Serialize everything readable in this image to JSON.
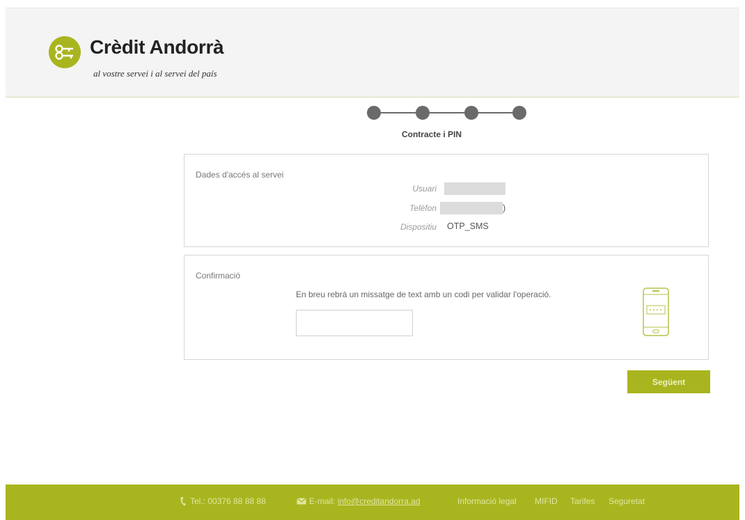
{
  "brand": {
    "name": "Crèdit Andorrà",
    "tagline": "al vostre servei i al servei del país",
    "color": "#a9b51f"
  },
  "steps": {
    "count": 4,
    "current_label": "Contracte i PIN"
  },
  "access_panel": {
    "title": "Dades d'accés al servei",
    "fields": [
      {
        "label": "Usuari",
        "value": ""
      },
      {
        "label": "Telèfon",
        "value": ")"
      },
      {
        "label": "Dispositiu",
        "value": "OTP_SMS"
      }
    ]
  },
  "confirm_panel": {
    "title": "Confirmació",
    "message": "En breu rebrà un missatge de text amb un codi per validar l'operació.",
    "code_input": {
      "value": "",
      "placeholder": ""
    },
    "icon": "smartphone-icon"
  },
  "actions": {
    "next_label": "Següent"
  },
  "footer": {
    "phone": "Tel.: 00376 88 88 88",
    "email_label": "E-mail: ",
    "email": "info@creditandorra.ad",
    "links": [
      "Informació legal",
      "MIFID",
      "Tarifes",
      "Seguretat"
    ]
  }
}
